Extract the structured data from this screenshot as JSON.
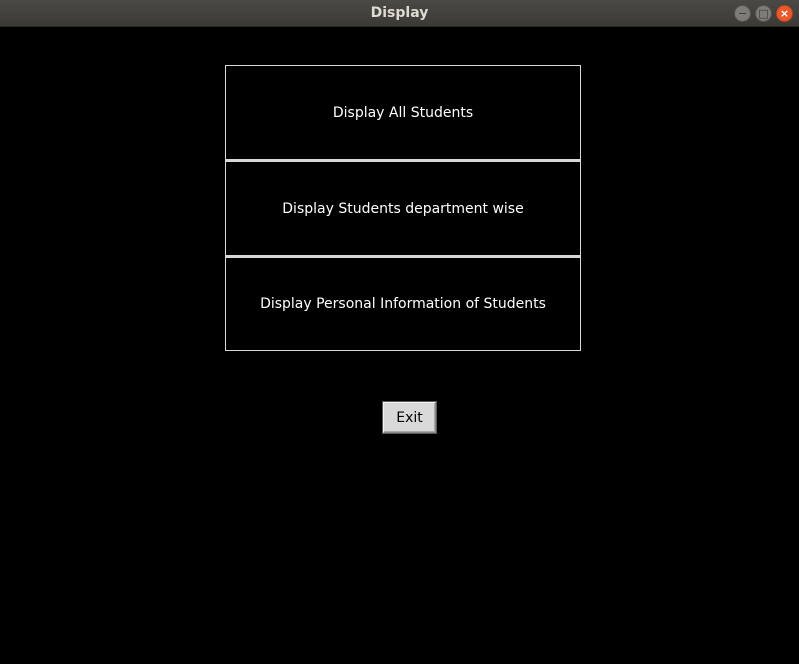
{
  "window": {
    "title": "Display",
    "controls": {
      "minimize_icon": "−",
      "maximize_icon": "□",
      "close_icon": "×"
    }
  },
  "menu": {
    "options": [
      {
        "label": "Display All Students"
      },
      {
        "label": "Display Students department wise"
      },
      {
        "label": "Display Personal Information of Students"
      }
    ],
    "exit_label": "Exit"
  },
  "colors": {
    "background": "#000000",
    "titlebar": "#3e3d39",
    "option_border": "#d9d9d9",
    "option_text": "#ffffff",
    "exit_button_bg": "#d9d9d9",
    "close_button": "#e8592b"
  }
}
